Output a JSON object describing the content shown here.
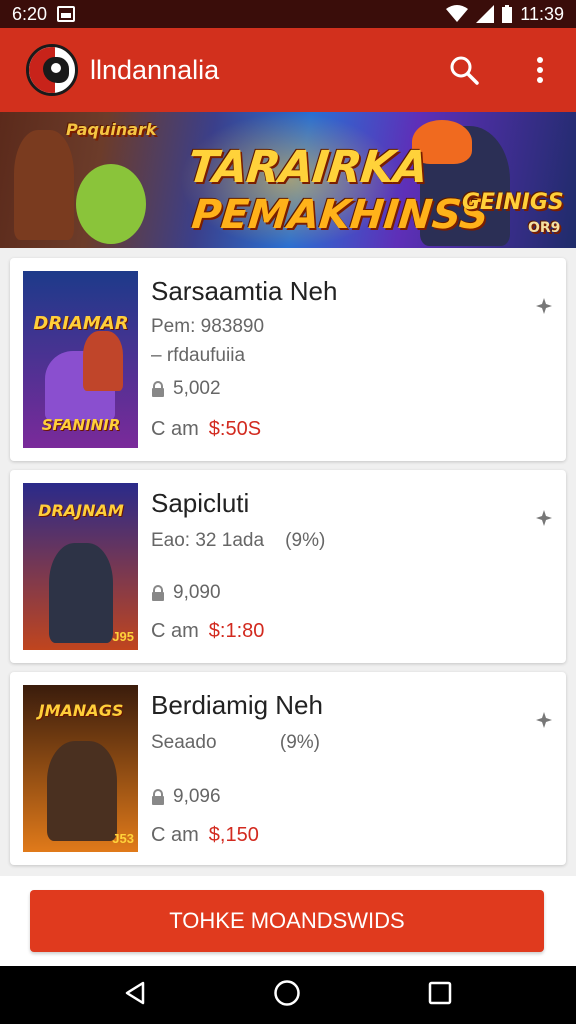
{
  "status_bar": {
    "time_left": "6:20",
    "time_right": "11:39"
  },
  "app_bar": {
    "title": "llndannalia"
  },
  "banner": {
    "small_title": "Paquinark",
    "headline_1": "TARAIRKA",
    "headline_2": "PEMAKHINSS",
    "badge": "GEINIGS",
    "badge_sub": "OR9"
  },
  "games": [
    {
      "thumb_title": "DRIAMAR",
      "thumb_footer": "SFANINIR",
      "title": "Sarsaamtia Neh",
      "line1": "Pem: 983890",
      "line2": "– rfdaufuiia",
      "size": "5,002",
      "price_label": "C am",
      "price": "$:50S",
      "colors": {
        "top": "#1d3a8a",
        "bottom": "#7a2a9a",
        "fig": "#8a4fcf"
      }
    },
    {
      "thumb_title": "DRAJNAM",
      "thumb_footer": "J95",
      "title": "Sapicluti",
      "line1": "Eao: 32 1ada",
      "line1_extra": "(9%)",
      "size": "9,090",
      "price_label": "C am",
      "price": "$:1:80",
      "colors": {
        "top": "#2a2a8a",
        "bottom": "#c0451e",
        "fig": "#2d3346"
      }
    },
    {
      "thumb_title": "JMANAGS",
      "thumb_footer": "J53",
      "title": "Berdiamig Neh",
      "line1": "Seaado",
      "line1_extra": "(9%)",
      "size": "9,096",
      "price_label": "C am",
      "price": "$,150",
      "colors": {
        "top": "#3a1c0c",
        "bottom": "#e07a1a",
        "fig": "#4a3020"
      }
    }
  ],
  "cta": {
    "label": "TOHKE MOANDSWIDS"
  },
  "icons": {
    "search": "search-icon",
    "overflow": "more-vert-icon",
    "back": "back-triangle-icon",
    "home": "home-circle-icon",
    "recents": "recents-square-icon"
  },
  "colors": {
    "app_bar": "#d2301d",
    "accent": "#e03a1e",
    "price": "#d22a1f"
  }
}
